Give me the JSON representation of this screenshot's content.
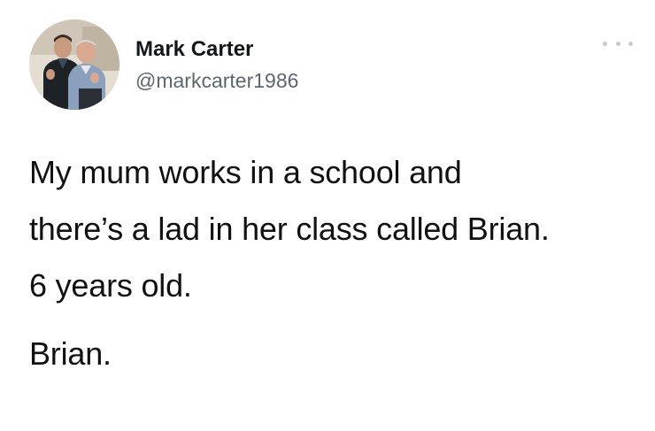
{
  "author": {
    "display_name": "Mark Carter",
    "handle": "@markcarter1986"
  },
  "icons": {
    "more": "more-options-icon",
    "avatar": "profile-photo"
  },
  "tweet": {
    "lines": [
      "My mum works in a school and",
      "there’s a lad in her class called Brian.",
      "6 years old.",
      "Brian."
    ]
  },
  "colors": {
    "name": "#14171a",
    "handle": "#5b6670",
    "dots": "#c5cbd1",
    "text": "#111111"
  }
}
